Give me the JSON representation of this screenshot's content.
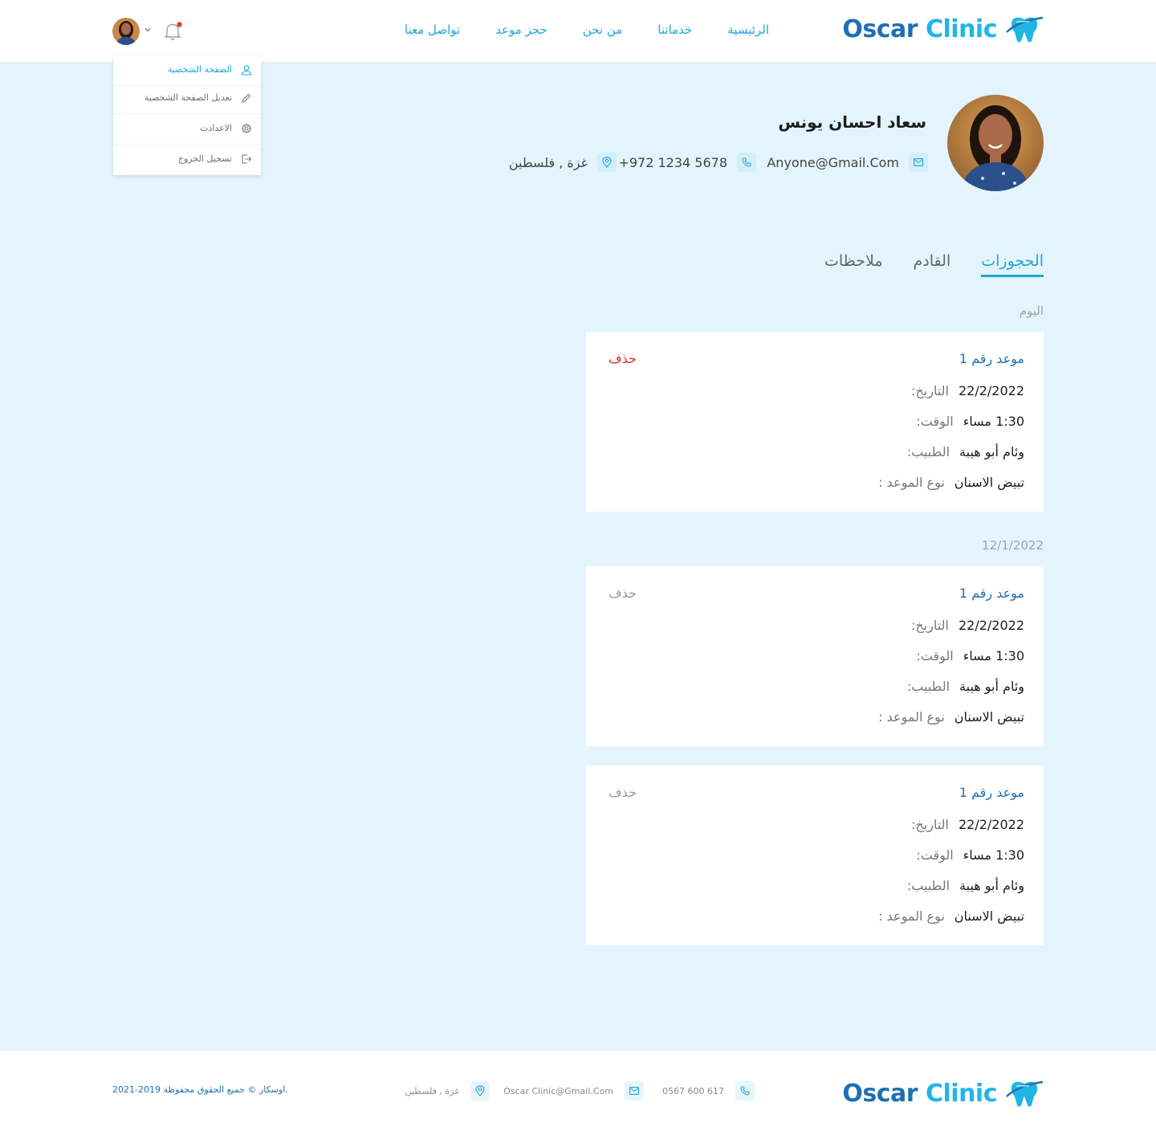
{
  "brand": {
    "word1": "Oscar",
    "word2": "Clinic"
  },
  "nav": [
    "الرئيسية",
    "خدماتنا",
    "من نحن",
    "حجز موعد",
    "تواصل معنا"
  ],
  "user_menu": {
    "items": [
      {
        "label": "الصفحة الشخصية",
        "icon": "user-icon"
      },
      {
        "label": "تعديل الصفحة الشخصية",
        "icon": "pencil-icon"
      },
      {
        "label": "الاعدادت",
        "icon": "gear-icon"
      },
      {
        "label": "تسجيل الخروج",
        "icon": "logout-icon"
      }
    ]
  },
  "profile": {
    "name": "سعاد احسان يونس",
    "email": "Anyone@Gmail.Com",
    "phone": "+972 1234 5678",
    "location": "غزة , فلسطين"
  },
  "tabs": [
    "الحجوزات",
    "القادم",
    "ملاحظات"
  ],
  "sections": [
    {
      "label": "اليوم",
      "cards": [
        {
          "title": "موعد رقم 1",
          "delete": "حذف",
          "date_k": "التاريخ:",
          "date_v": "22/2/2022",
          "time_k": "الوقت:",
          "time_v": "1:30 مساء",
          "doctor_k": "الطبيب:",
          "doctor_v": "وئام أبو هيبة",
          "type_k": "نوع الموعد :",
          "type_v": "تبيض الاسنان"
        }
      ]
    },
    {
      "label": "12/1/2022",
      "cards": [
        {
          "title": "موعد رقم 1",
          "delete": "حذف",
          "date_k": "التاريخ:",
          "date_v": "22/2/2022",
          "time_k": "الوقت:",
          "time_v": "1:30 مساء",
          "doctor_k": "الطبيب:",
          "doctor_v": "وئام أبو هيبة",
          "type_k": "نوع الموعد :",
          "type_v": "تبيض الاسنان"
        },
        {
          "title": "موعد رقم 1",
          "delete": "حذف",
          "date_k": "التاريخ:",
          "date_v": "22/2/2022",
          "time_k": "الوقت:",
          "time_v": "1:30 مساء",
          "doctor_k": "الطبيب:",
          "doctor_v": "وئام أبو هيبة",
          "type_k": "نوع الموعد :",
          "type_v": "تبيض الاسنان"
        }
      ]
    }
  ],
  "footer": {
    "phone": "0567 600 617",
    "email": "Oscar Clinic@Gmail.Com",
    "location": "غزة , فلسطين",
    "copyright": "2021-2019  اوسكار ©  جميع الحقوق محفوظة."
  },
  "colors": {
    "primary": "#1f6fb2",
    "accent": "#1fb6e6",
    "danger": "#d92e2e",
    "background": "#e3f4fc"
  }
}
